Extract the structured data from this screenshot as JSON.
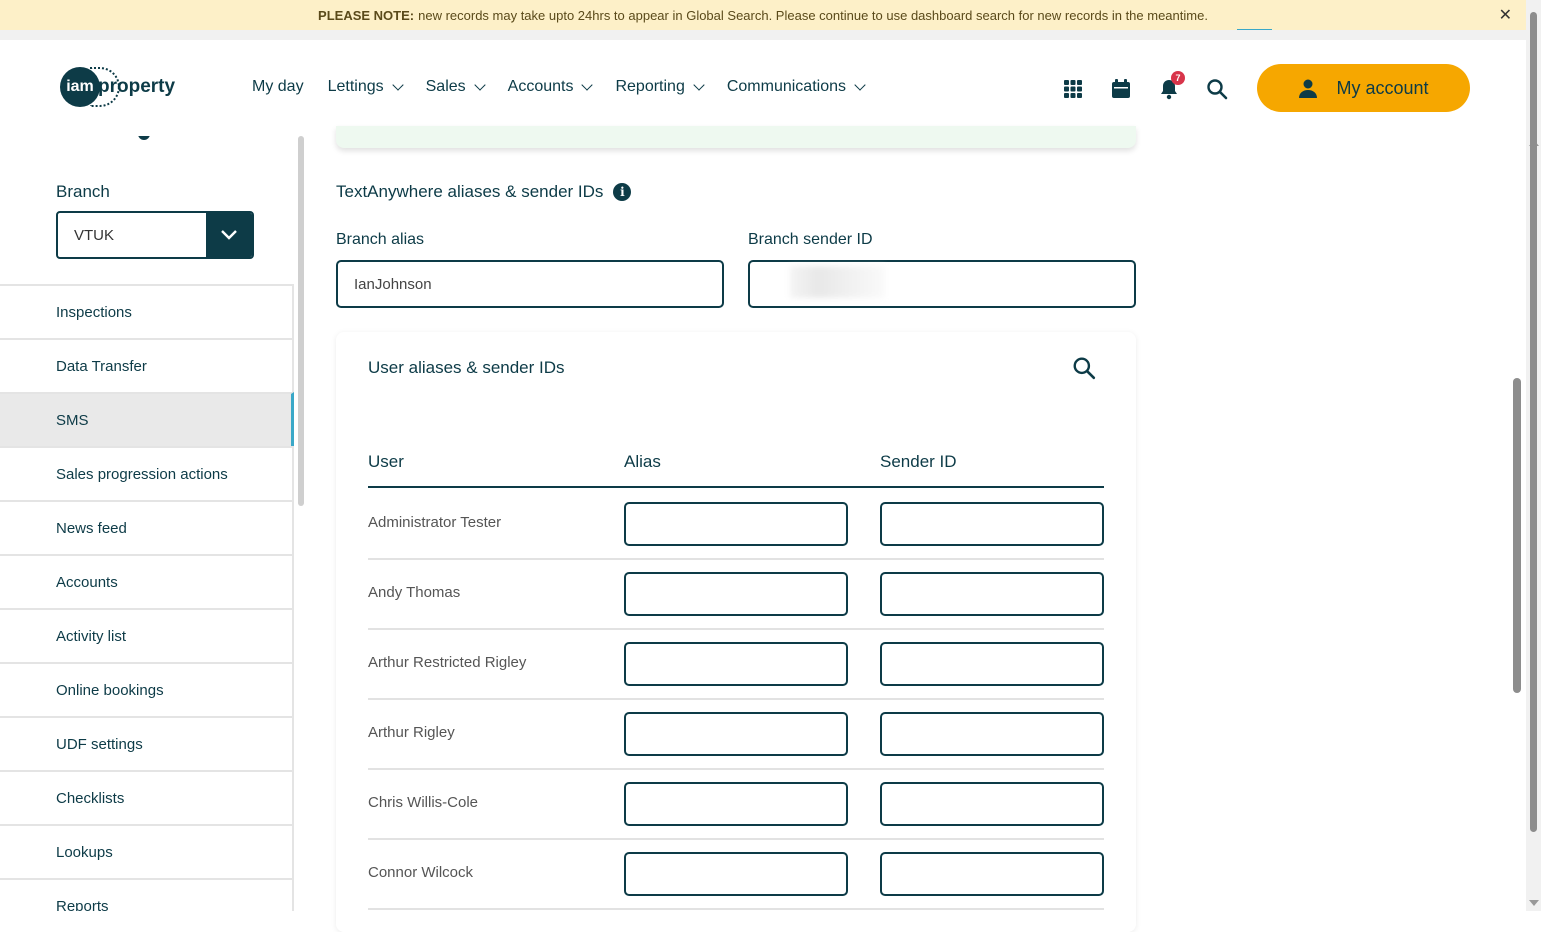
{
  "banner": {
    "strong": "PLEASE NOTE:",
    "text": "new records may take upto 24hrs to appear in Global Search. Please continue to use dashboard search for new records in the meantime.",
    "close": "✕"
  },
  "header": {
    "logo_iam": "iam",
    "logo_word": "property",
    "nav": [
      "My day",
      "Lettings",
      "Sales",
      "Accounts",
      "Reporting",
      "Communications"
    ],
    "notification_count": "7",
    "my_account": "My account"
  },
  "sidebar": {
    "branch_label": "Branch",
    "branch_value": "VTUK",
    "items": [
      "Inspections",
      "Data Transfer",
      "SMS",
      "Sales progression actions",
      "News feed",
      "Accounts",
      "Activity list",
      "Online bookings",
      "UDF settings",
      "Checklists",
      "Lookups",
      "Reports"
    ],
    "active_item": "SMS"
  },
  "textanywhere": {
    "title": "TextAnywhere aliases & sender IDs",
    "info_icon": "i",
    "branch_alias_label": "Branch alias",
    "branch_alias_value": "IanJohnson",
    "branch_sender_label": "Branch sender ID",
    "branch_sender_value": ""
  },
  "users_card": {
    "title": "User aliases & sender IDs",
    "columns": [
      "User",
      "Alias",
      "Sender ID"
    ],
    "rows": [
      {
        "user": "Administrator Tester",
        "alias": "",
        "sender_id": ""
      },
      {
        "user": "Andy Thomas",
        "alias": "",
        "sender_id": ""
      },
      {
        "user": "Arthur Restricted Rigley",
        "alias": "",
        "sender_id": ""
      },
      {
        "user": "Arthur Rigley",
        "alias": "",
        "sender_id": ""
      },
      {
        "user": "Chris Willis-Cole",
        "alias": "",
        "sender_id": ""
      },
      {
        "user": "Connor Wilcock",
        "alias": "",
        "sender_id": ""
      }
    ]
  },
  "colors": {
    "primary": "#0d3b47",
    "accent": "#f6a700",
    "banner_bg": "#fdf0c8",
    "active_marker": "#3aa8c8",
    "badge": "#d8344a"
  }
}
